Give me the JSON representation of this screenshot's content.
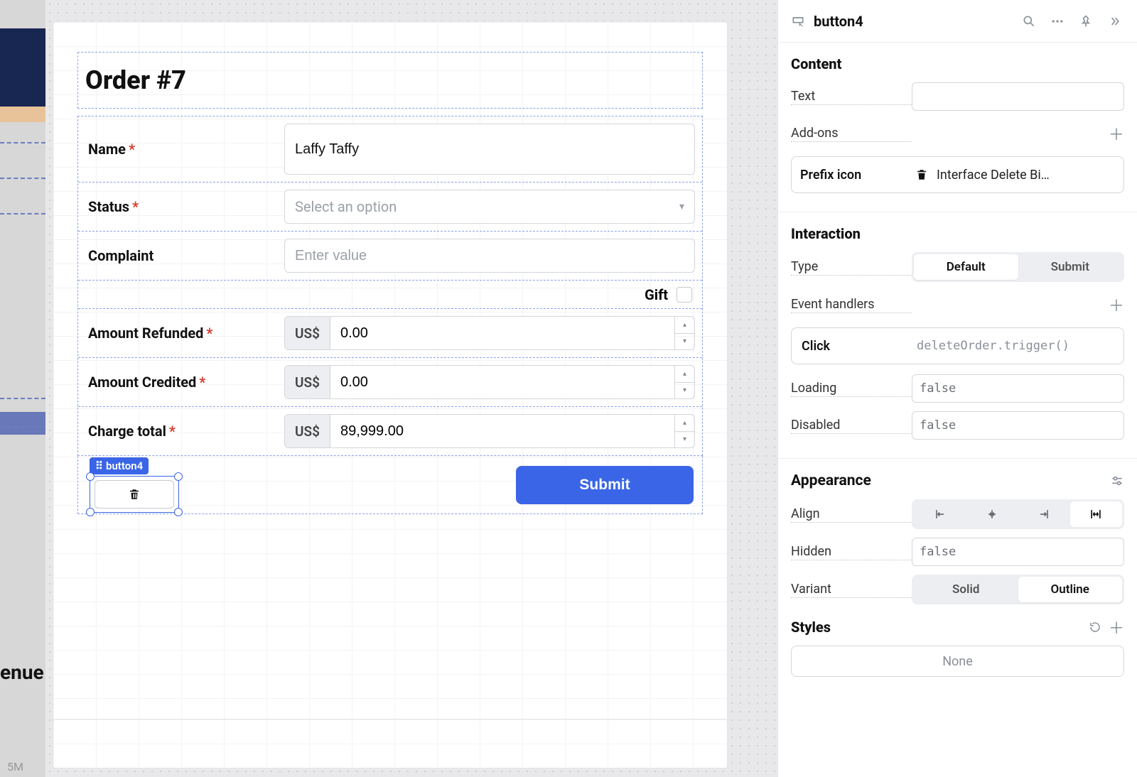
{
  "ghost": {
    "nue_text": "enue",
    "five_m": "5M"
  },
  "form": {
    "title": "Order #7",
    "fields": {
      "name": {
        "label": "Name",
        "required": true,
        "value": "Laffy Taffy"
      },
      "status": {
        "label": "Status",
        "required": true,
        "placeholder": "Select an option"
      },
      "complaint": {
        "label": "Complaint",
        "required": false,
        "placeholder": "Enter value"
      },
      "gift": {
        "label": "Gift"
      },
      "amount_refunded": {
        "label": "Amount Refunded",
        "required": true,
        "prefix": "US$",
        "value": "0.00"
      },
      "amount_credited": {
        "label": "Amount Credited",
        "required": true,
        "prefix": "US$",
        "value": "0.00"
      },
      "charge_total": {
        "label": "Charge total",
        "required": true,
        "prefix": "US$",
        "value": "89,999.00"
      }
    },
    "selected_tag": "button4",
    "submit_label": "Submit"
  },
  "inspector": {
    "component_name": "button4",
    "sections": {
      "content": {
        "heading": "Content",
        "text_label": "Text",
        "text_value": "",
        "addons_label": "Add-ons",
        "addon": {
          "label": "Prefix icon",
          "value": "Interface Delete Bi…"
        }
      },
      "interaction": {
        "heading": "Interaction",
        "type_label": "Type",
        "type_options": [
          "Default",
          "Submit"
        ],
        "type_active": "Default",
        "event_handlers_label": "Event handlers",
        "handler": {
          "event": "Click",
          "code": "deleteOrder.trigger()"
        },
        "loading_label": "Loading",
        "loading_value": "false",
        "disabled_label": "Disabled",
        "disabled_value": "false"
      },
      "appearance": {
        "heading": "Appearance",
        "align_label": "Align",
        "align_active": "stretch",
        "hidden_label": "Hidden",
        "hidden_value": "false",
        "variant_label": "Variant",
        "variant_options": [
          "Solid",
          "Outline"
        ],
        "variant_active": "Outline",
        "styles_label": "Styles",
        "styles_none": "None"
      }
    }
  }
}
